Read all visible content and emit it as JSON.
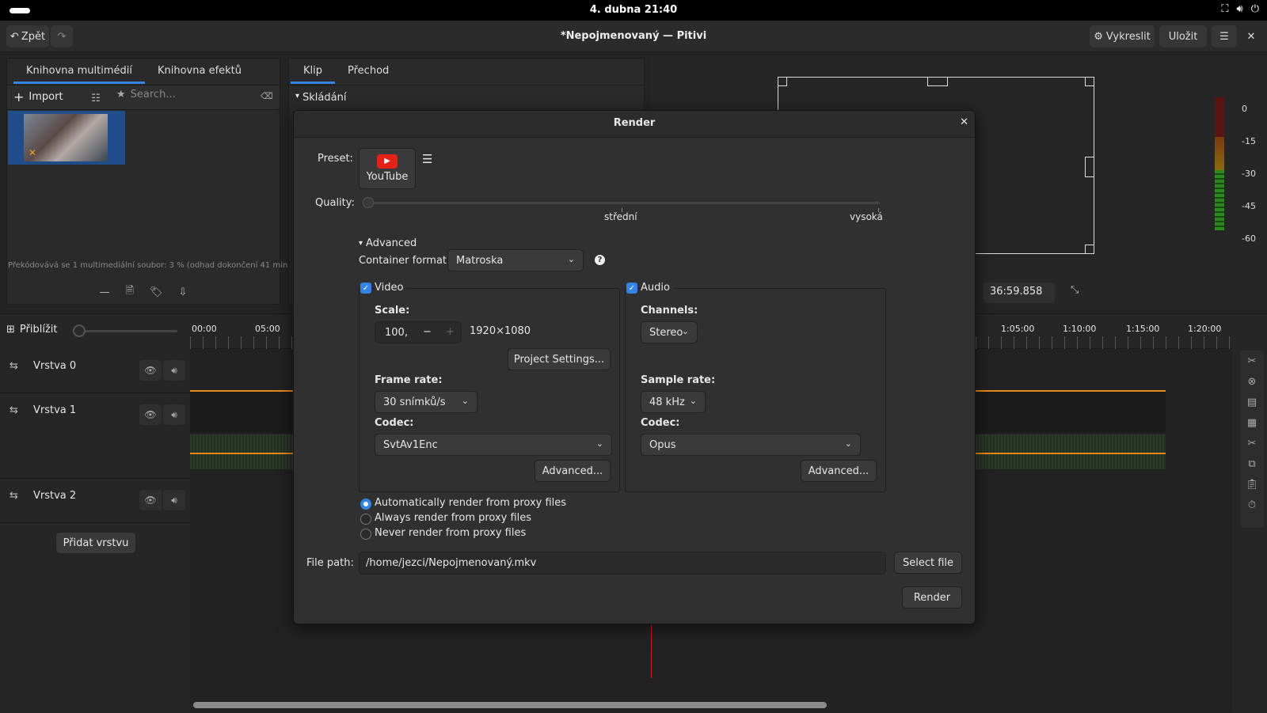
{
  "topbar": {
    "clock": "4. dubna  21:40",
    "icons": [
      "network-icon",
      "volume-icon",
      "power-icon"
    ]
  },
  "header": {
    "back_label": "Zpět",
    "title": "*Nepojmenovaný — Pitivi",
    "render_label": "Vykreslit",
    "save_label": "Uložit"
  },
  "media_library": {
    "tabs": [
      "Knihovna multimédií",
      "Knihovna efektů"
    ],
    "import_label": "Import",
    "search_placeholder": "Search...",
    "status": "Překódovává se 1 multimediální soubor: 3 % (odhad dokončení 41 minut)"
  },
  "clip_panel": {
    "tabs": [
      "Klip",
      "Přechod"
    ],
    "section": "Skládání"
  },
  "viewer": {
    "timecode": "36:59.858",
    "meter_labels": [
      "0",
      "-15",
      "-30",
      "-45",
      "-60"
    ]
  },
  "timeline": {
    "zoom_label": "Přiblížit",
    "ruler_left": [
      "00:00",
      "05:00"
    ],
    "ruler_right": [
      "1:05:00",
      "1:10:00",
      "1:15:00",
      "1:20:00"
    ],
    "layers": [
      "Vrstva 0",
      "Vrstva 1",
      "Vrstva 2"
    ],
    "add_layer_label": "Přidat vrstvu"
  },
  "dialog": {
    "title": "Render",
    "preset_label": "Preset:",
    "preset_name": "YouTube",
    "quality_label": "Quality:",
    "quality_ticks": [
      "střední",
      "vysoká"
    ],
    "quality_value": 0.0,
    "advanced_label": "Advanced",
    "container_label": "Container format:",
    "container_value": "Matroska",
    "video": {
      "label": "Video",
      "enabled": true,
      "scale_label": "Scale:",
      "scale_value": "100,",
      "resolution": "1920×1080",
      "project_settings_label": "Project Settings...",
      "framerate_label": "Frame rate:",
      "framerate_value": "30 snímků/s",
      "codec_label": "Codec:",
      "codec_value": "SvtAv1Enc",
      "advanced_label": "Advanced..."
    },
    "audio": {
      "label": "Audio",
      "enabled": true,
      "channels_label": "Channels:",
      "channels_value": "Stereo",
      "samplerate_label": "Sample rate:",
      "samplerate_value": "48 kHz",
      "codec_label": "Codec:",
      "codec_value": "Opus",
      "advanced_label": "Advanced..."
    },
    "proxy_options": [
      "Automatically render from proxy files",
      "Always render from proxy files",
      "Never render from proxy files"
    ],
    "proxy_selected": 0,
    "filepath_label": "File path:",
    "filepath_value": "/home/jezci/Nepojmenovaný.mkv",
    "select_file_label": "Select file",
    "render_button_label": "Render"
  }
}
